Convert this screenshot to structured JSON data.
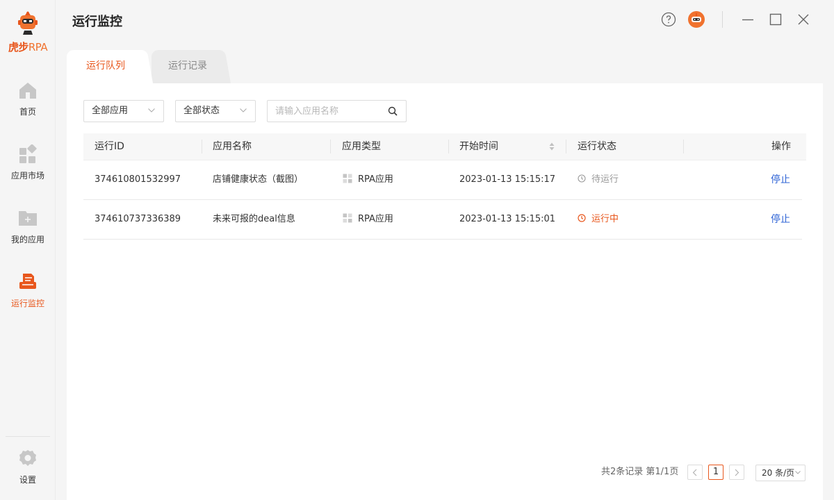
{
  "app": {
    "logo_cn": "虎步",
    "logo_en": "RPA"
  },
  "sidebar": {
    "items": [
      {
        "label": "首页",
        "icon": "home-icon"
      },
      {
        "label": "应用市场",
        "icon": "app-market-icon"
      },
      {
        "label": "我的应用",
        "icon": "folder-add-icon"
      },
      {
        "label": "运行监控",
        "icon": "monitor-icon",
        "active": true
      }
    ],
    "settings_label": "设置"
  },
  "header": {
    "title": "运行监控",
    "icons": [
      "help-icon",
      "robot-avatar-icon",
      "minimize-icon",
      "maximize-icon",
      "close-icon"
    ]
  },
  "tabs": [
    {
      "label": "运行队列",
      "active": true
    },
    {
      "label": "运行记录",
      "active": false
    }
  ],
  "filters": {
    "app_filter": "全部应用",
    "status_filter": "全部状态",
    "search_placeholder": "请输入应用名称",
    "search_value": ""
  },
  "table": {
    "columns": [
      "运行ID",
      "应用名称",
      "应用类型",
      "开始时间",
      "运行状态",
      "操作"
    ],
    "rows": [
      {
        "id": "374610801532997",
        "name": "店铺健康状态（截图）",
        "type": "RPA应用",
        "start": "2023-01-13 15:15:17",
        "status": "待运行",
        "status_kind": "waiting",
        "action": "停止"
      },
      {
        "id": "374610737336389",
        "name": "未来可报的deal信息",
        "type": "RPA应用",
        "start": "2023-01-13 15:15:01",
        "status": "运行中",
        "status_kind": "running",
        "action": "停止"
      }
    ]
  },
  "pagination": {
    "summary": "共2条记录 第1/1页",
    "current_page": "1",
    "page_size": "20 条/页"
  },
  "colors": {
    "accent": "#e8571d",
    "link": "#2f64d6",
    "waiting": "#999999"
  }
}
